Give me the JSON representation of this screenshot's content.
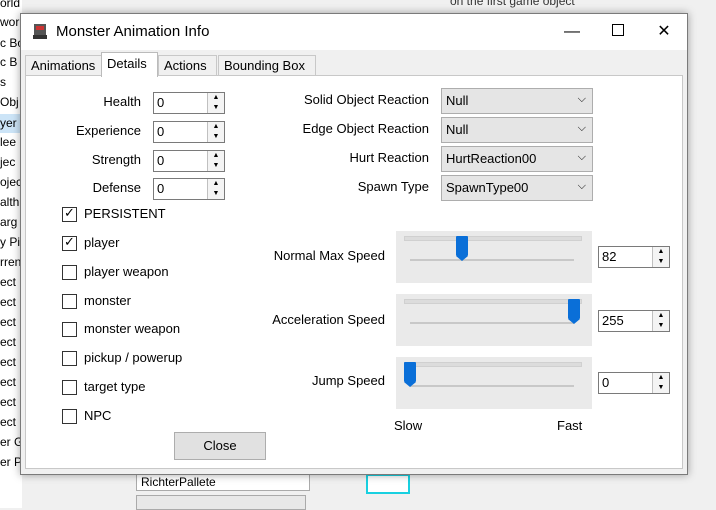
{
  "background": {
    "left_items": [
      "orld",
      "wor",
      "c Bo",
      "c B",
      "s",
      "Obj",
      "yer",
      "lee",
      "jec",
      "ojec",
      "alth",
      "arg",
      "y Pi",
      "rren",
      "ect",
      "ect",
      "ect",
      "ect",
      "ect",
      "ect",
      "ect",
      "ect",
      "er G",
      "er P"
    ],
    "top_text": "on the first game object",
    "palette_label": "RichterPallete"
  },
  "dialog": {
    "title": "Monster Animation Info",
    "tabs": [
      "Animations",
      "Details",
      "Actions",
      "Bounding Box"
    ],
    "active_tab": "Details",
    "stats": [
      {
        "label": "Health",
        "value": "0"
      },
      {
        "label": "Experience",
        "value": "0"
      },
      {
        "label": "Strength",
        "value": "0"
      },
      {
        "label": "Defense",
        "value": "0"
      }
    ],
    "flags": [
      {
        "label": "PERSISTENT",
        "checked": true
      },
      {
        "label": "player",
        "checked": true
      },
      {
        "label": "player weapon",
        "checked": false
      },
      {
        "label": "monster",
        "checked": false
      },
      {
        "label": "monster weapon",
        "checked": false
      },
      {
        "label": "pickup / powerup",
        "checked": false
      },
      {
        "label": "target type",
        "checked": false
      },
      {
        "label": "NPC",
        "checked": false
      }
    ],
    "reactions": [
      {
        "label": "Solid Object Reaction",
        "value": "Null"
      },
      {
        "label": "Edge Object Reaction",
        "value": "Null"
      },
      {
        "label": "Hurt Reaction",
        "value": "HurtReaction00"
      },
      {
        "label": "Spawn Type",
        "value": "SpawnType00"
      }
    ],
    "speeds": [
      {
        "label": "Normal Max Speed",
        "value": "82",
        "fraction": 0.32
      },
      {
        "label": "Acceleration Speed",
        "value": "255",
        "fraction": 1.0
      },
      {
        "label": "Jump Speed",
        "value": "0",
        "fraction": 0.0
      }
    ],
    "slow_label": "Slow",
    "fast_label": "Fast",
    "close_label": "Close"
  }
}
